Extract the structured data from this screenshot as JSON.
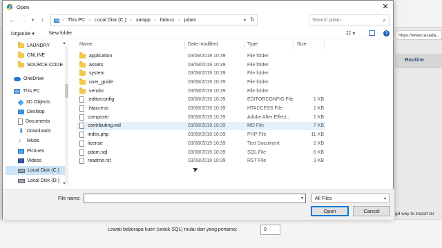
{
  "background": {
    "url_fragment": "https://www.lazada...",
    "nav_item": "Routine",
    "note": "gd way to import lar",
    "skip_label": "Lewati beberapa kueri (untuk SQL) mulai dari yang pertama:",
    "skip_value": "0"
  },
  "dialog": {
    "title": "Open",
    "close": "✕"
  },
  "address": {
    "crumbs": [
      "This PC",
      "Local Disk (C:)",
      "xampp",
      "htdocs",
      "pdam"
    ],
    "search_placeholder": "Search pdam"
  },
  "toolbar": {
    "organize": "Organize ▾",
    "new_folder": "New folder"
  },
  "nav": {
    "items": [
      {
        "label": "LAUNDRY",
        "icon": "folder-icon"
      },
      {
        "label": "ONLINE",
        "icon": "folder-icon"
      },
      {
        "label": "SOURCE CODE",
        "icon": "folder-icon"
      },
      {
        "label": "OneDrive",
        "icon": "onedrive-icon"
      },
      {
        "label": "This PC",
        "icon": "this-pc-icon"
      },
      {
        "label": "3D Objects",
        "icon": "3d-objects-icon"
      },
      {
        "label": "Desktop",
        "icon": "desktop-icon"
      },
      {
        "label": "Documents",
        "icon": "documents-icon"
      },
      {
        "label": "Downloads",
        "icon": "downloads-icon"
      },
      {
        "label": "Music",
        "icon": "music-icon"
      },
      {
        "label": "Pictures",
        "icon": "pictures-icon"
      },
      {
        "label": "Videos",
        "icon": "videos-icon"
      },
      {
        "label": "Local Disk (C:)",
        "icon": "drive-icon",
        "selected": true
      },
      {
        "label": "Local Disk (D:)",
        "icon": "drive-icon"
      }
    ]
  },
  "columns": {
    "name": "Name",
    "date": "Date modified",
    "type": "Type",
    "size": "Size"
  },
  "files": [
    {
      "name": "application",
      "date": "03/08/2019 10:39",
      "type": "File folder",
      "size": "",
      "folder": true
    },
    {
      "name": "assets",
      "date": "03/08/2019 10:39",
      "type": "File folder",
      "size": "",
      "folder": true
    },
    {
      "name": "system",
      "date": "03/08/2019 10:39",
      "type": "File folder",
      "size": "",
      "folder": true
    },
    {
      "name": "user_guide",
      "date": "03/08/2019 10:39",
      "type": "File folder",
      "size": "",
      "folder": true
    },
    {
      "name": "vendor",
      "date": "03/08/2019 10:39",
      "type": "File folder",
      "size": "",
      "folder": true
    },
    {
      "name": ".editorconfig",
      "date": "03/08/2019 10:39",
      "type": "EDITORCONFIG File",
      "size": "1 KB",
      "folder": false
    },
    {
      "name": ".htaccess",
      "date": "03/08/2019 10:39",
      "type": "HTACCESS File",
      "size": "1 KB",
      "folder": false
    },
    {
      "name": "composer",
      "date": "03/08/2019 10:39",
      "type": "Adobe After Effect...",
      "size": "1 KB",
      "folder": false
    },
    {
      "name": "contributing.md",
      "date": "03/08/2019 10:39",
      "type": "MD File",
      "size": "7 KB",
      "folder": false
    },
    {
      "name": "index.php",
      "date": "03/08/2019 10:39",
      "type": "PHP File",
      "size": "11 KB",
      "folder": false
    },
    {
      "name": "license",
      "date": "03/08/2019 10:39",
      "type": "Text Document",
      "size": "2 KB",
      "folder": false
    },
    {
      "name": "pdam.sql",
      "date": "03/08/2019 10:39",
      "type": "SQL File",
      "size": "6 KB",
      "folder": false
    },
    {
      "name": "readme.rst",
      "date": "03/08/2019 10:39",
      "type": "RST File",
      "size": "3 KB",
      "folder": false
    }
  ],
  "bottom": {
    "file_name_label": "File name:",
    "file_name_value": "",
    "filter": "All Files",
    "open": "Open",
    "cancel": "Cancel"
  }
}
